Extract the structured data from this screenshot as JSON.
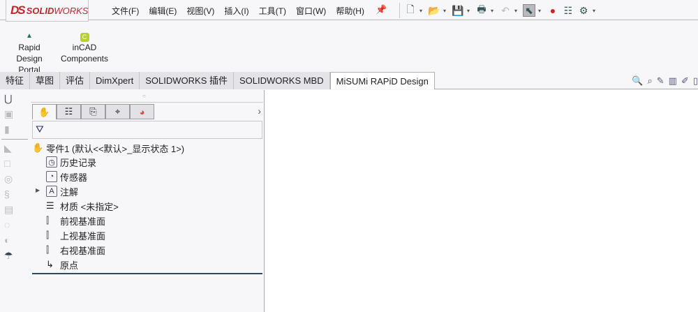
{
  "app": {
    "logo_prefix": "DS",
    "logo_bold": "SOLID",
    "logo_rest": "WORKS"
  },
  "menu": [
    "文件(F)",
    "编辑(E)",
    "视图(V)",
    "插入(I)",
    "工具(T)",
    "窗口(W)",
    "帮助(H)"
  ],
  "ribbon": {
    "rapid_design_portal": "Rapid Design Portal",
    "incad_components": "inCAD Components"
  },
  "tabs": [
    "特征",
    "草图",
    "评估",
    "DimXpert",
    "SOLIDWORKS 插件",
    "SOLIDWORKS MBD",
    "MiSUMi RAPiD Design"
  ],
  "active_tab": 6,
  "tree": {
    "root": "零件1  (默认<<默认>_显示状态 1>)",
    "items": [
      "历史记录",
      "传感器",
      "注解",
      "材质 <未指定>",
      "前视基准面",
      "上视基准面",
      "右视基准面",
      "原点"
    ]
  },
  "panel": {
    "expand_arrow": "›"
  }
}
